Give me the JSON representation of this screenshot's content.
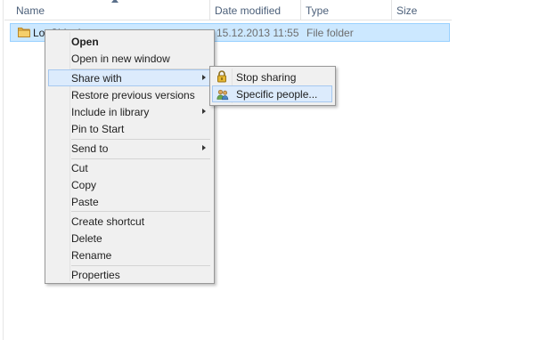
{
  "columns": {
    "name": "Name",
    "date_modified": "Date modified",
    "type": "Type",
    "size": "Size"
  },
  "file_row": {
    "name": "LogShipping",
    "date_modified": "15.12.2013 11:55",
    "type": "File folder",
    "icon": "folder-icon"
  },
  "context_menu": {
    "open": "Open",
    "open_new_window": "Open in new window",
    "share_with": "Share with",
    "restore_previous_versions": "Restore previous versions",
    "include_in_library": "Include in library",
    "pin_to_start": "Pin to Start",
    "send_to": "Send to",
    "cut": "Cut",
    "copy": "Copy",
    "paste": "Paste",
    "create_shortcut": "Create shortcut",
    "delete": "Delete",
    "rename": "Rename",
    "properties": "Properties"
  },
  "share_submenu": {
    "stop_sharing": "Stop sharing",
    "specific_people": "Specific people...",
    "stop_sharing_icon": "lock-icon",
    "specific_people_icon": "people-icon"
  },
  "colors": {
    "selection_fill": "#cce8ff",
    "selection_border": "#99d1ff",
    "menu_bg": "#f0f0f0",
    "menu_hover": "#dcebfc"
  }
}
